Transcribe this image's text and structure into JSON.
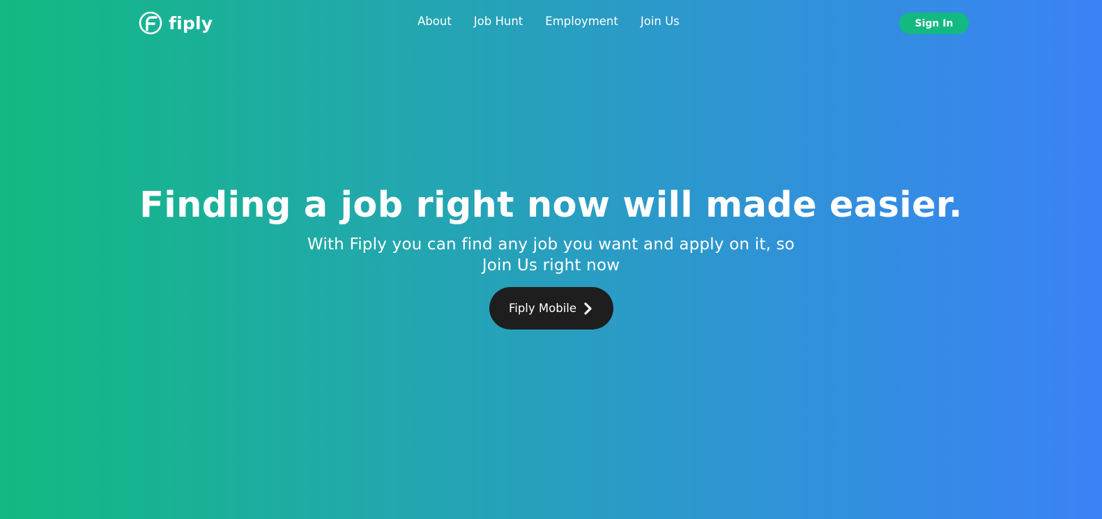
{
  "brand": {
    "name": "fiply",
    "logo_icon": "fiply-f-logo-icon"
  },
  "nav": {
    "links": [
      {
        "label": "About"
      },
      {
        "label": "Job Hunt"
      },
      {
        "label": "Employment"
      },
      {
        "label": "Join Us"
      }
    ],
    "signin_label": "Sign In"
  },
  "hero": {
    "title": "Finding a job right now will made easier.",
    "subtitle": "With Fiply you can find any job you want and apply on it, so Join Us right now",
    "cta_label": "Fiply Mobile",
    "cta_icon": "chevron-right-icon"
  },
  "colors": {
    "gradient_start": "#12b981",
    "gradient_end": "#3b82f6",
    "signin_button": "#12b981",
    "cta_button": "#1e1e1e",
    "text": "#ffffff"
  }
}
